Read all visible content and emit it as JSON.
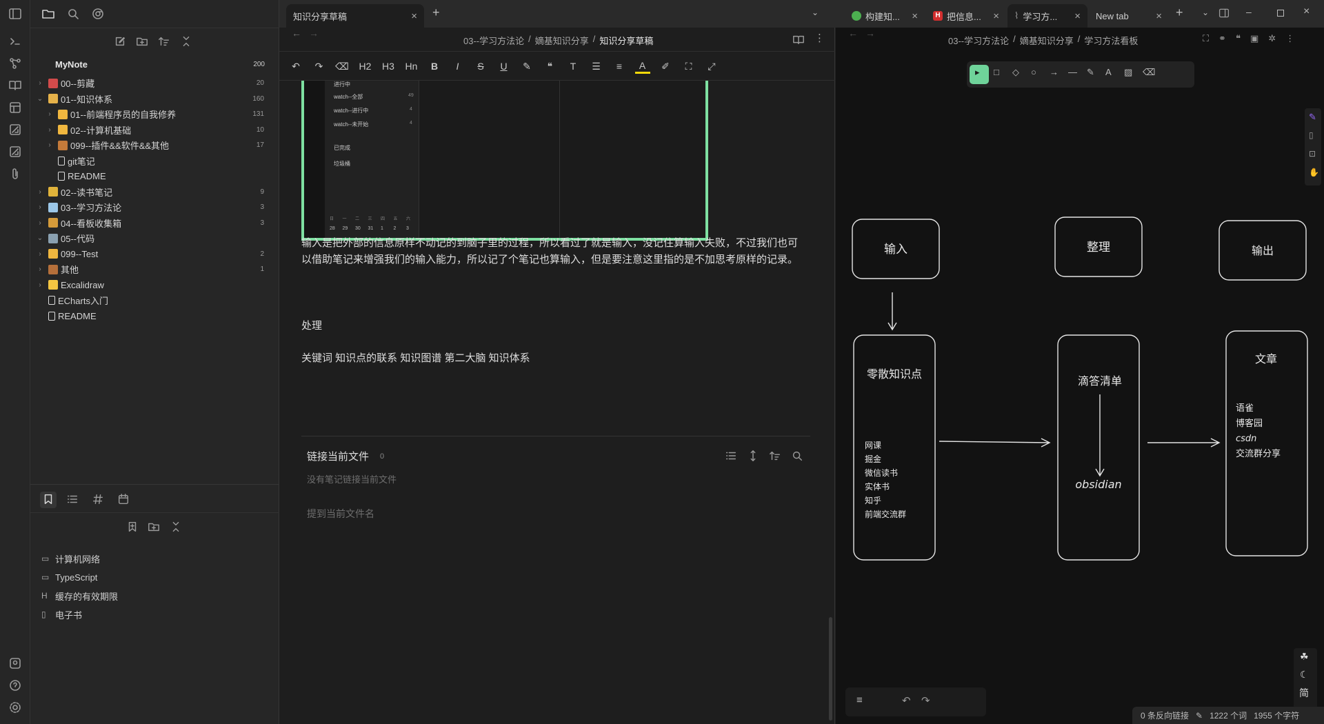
{
  "ribbon": {
    "icons": [
      "sidebar-toggle-icon",
      "terminal-icon",
      "graph-icon",
      "book-icon",
      "layout-icon",
      "dice-icon",
      "dice-icon-2",
      "paperclip-icon",
      "help-circle-icon",
      "question-icon",
      "settings-icon"
    ]
  },
  "left_toolbar": {
    "icons": [
      "folder-icon",
      "search-icon",
      "chrome-icon"
    ]
  },
  "file_tree": {
    "header_icons": [
      "new-note-icon",
      "new-folder-icon",
      "sort-icon",
      "collapse-icon"
    ],
    "vault_name": "MyNote",
    "vault_count": "200",
    "items": [
      {
        "label": "00--剪藏",
        "count": "20",
        "depth": 0,
        "chev": "›"
      },
      {
        "label": "01--知识体系",
        "count": "160",
        "depth": 0,
        "chev": "⌄"
      },
      {
        "label": "01--前端程序员的自我修养",
        "count": "131",
        "depth": 1,
        "chev": "›"
      },
      {
        "label": "02--计算机基础",
        "count": "10",
        "depth": 1,
        "chev": "›"
      },
      {
        "label": "099--插件&&软件&&其他",
        "count": "17",
        "depth": 1,
        "chev": "›"
      },
      {
        "label": "git笔记",
        "count": "",
        "depth": 1,
        "chev": ""
      },
      {
        "label": "README",
        "count": "",
        "depth": 1,
        "chev": ""
      },
      {
        "label": "02--读书笔记",
        "count": "9",
        "depth": 0,
        "chev": "›"
      },
      {
        "label": "03--学习方法论",
        "count": "3",
        "depth": 0,
        "chev": "›"
      },
      {
        "label": "04--看板收集箱",
        "count": "3",
        "depth": 0,
        "chev": "›"
      },
      {
        "label": "05--代码",
        "count": "",
        "depth": 0,
        "chev": "⌄"
      },
      {
        "label": "099--Test",
        "count": "2",
        "depth": 0,
        "chev": "›"
      },
      {
        "label": "其他",
        "count": "1",
        "depth": 0,
        "chev": "›"
      },
      {
        "label": "Excalidraw",
        "count": "",
        "depth": 0,
        "chev": "›"
      },
      {
        "label": "ECharts入门",
        "count": "",
        "depth": 0,
        "chev": ""
      },
      {
        "label": "README",
        "count": "",
        "depth": 0,
        "chev": ""
      }
    ]
  },
  "bookmarks": {
    "tab_icons": [
      "bookmark-icon",
      "list-icon",
      "tag-icon",
      "calendar-icon"
    ],
    "items": [
      {
        "label": "计算机网络",
        "icon": "folder"
      },
      {
        "label": "TypeScript",
        "icon": "folder"
      },
      {
        "label": "缓存的有效期限",
        "icon": "heading"
      },
      {
        "label": "电子书",
        "icon": "file"
      }
    ]
  },
  "tabs": {
    "left": {
      "label": "知识分享草稿",
      "close": "×",
      "plus": "+"
    },
    "right": [
      {
        "label": "构建知...",
        "close": "×"
      },
      {
        "label": "把信息...",
        "close": "×"
      },
      {
        "label": "学习方...",
        "close": "×"
      },
      {
        "label": "New tab",
        "close": "×"
      }
    ],
    "plus": "+"
  },
  "editor": {
    "breadcrumb": [
      "03--学习方法论",
      "/",
      "嫡基知识分享",
      "/",
      "知识分享草稿"
    ],
    "toolbar": [
      "↶",
      "↷",
      "⌫",
      "H2",
      "H3",
      "Hn",
      "B",
      "I",
      "S",
      "U",
      "✎",
      "❝",
      "T",
      "☰",
      "≡",
      "A",
      "✐",
      "⛶",
      "⤢"
    ],
    "screenshot_items": [
      "进行中",
      "watch--全部",
      "watch--进行中",
      "watch--未开始",
      "已完成",
      "垃圾桶"
    ],
    "screenshot_counts": [
      "49",
      "4",
      "4"
    ],
    "screenshot_dates": [
      "28",
      "29",
      "30",
      "31",
      "1",
      "2",
      "3"
    ],
    "screenshot_weekdays": [
      "日",
      "一",
      "二",
      "三",
      "四",
      "五",
      "六"
    ],
    "paragraph": "输入是把外部的信息原样不动记的到脑子里的过程，所以看过了就是输入，没记住算输入失败，不过我们也可以借助笔记来增强我们的输入能力，所以记了个笔记也算输入，但是要注意这里指的是不加思考原样的记录。",
    "heading": "处理",
    "keywords": "关键词 知识点的联系 知识图谱 第二大脑 知识体系",
    "backlinks_title": "链接当前文件",
    "backlinks_count": "0",
    "no_links": "没有笔记链接当前文件",
    "unlinked": "提到当前文件名"
  },
  "canvas": {
    "breadcrumb": [
      "03--学习方法论",
      "/",
      "嫡基知识分享",
      "/",
      "学习方法看板"
    ],
    "boxes": {
      "input": "输入",
      "organize": "整理",
      "output": "输出",
      "fragments_title": "零散知识点",
      "fragments": [
        "网课",
        "掘金",
        "微信读书",
        "实体书",
        "知乎",
        "前端交流群"
      ],
      "todo": "滴答清单",
      "obsidian": "obsidian",
      "article": "文章",
      "article_items": [
        "语雀",
        "博客园",
        "csdn",
        "交流群分享"
      ]
    },
    "status": {
      "backlinks": "0 条反向链接",
      "words": "1222 个词",
      "chars": "1955 个字符"
    },
    "side_labels": [
      "简"
    ]
  }
}
